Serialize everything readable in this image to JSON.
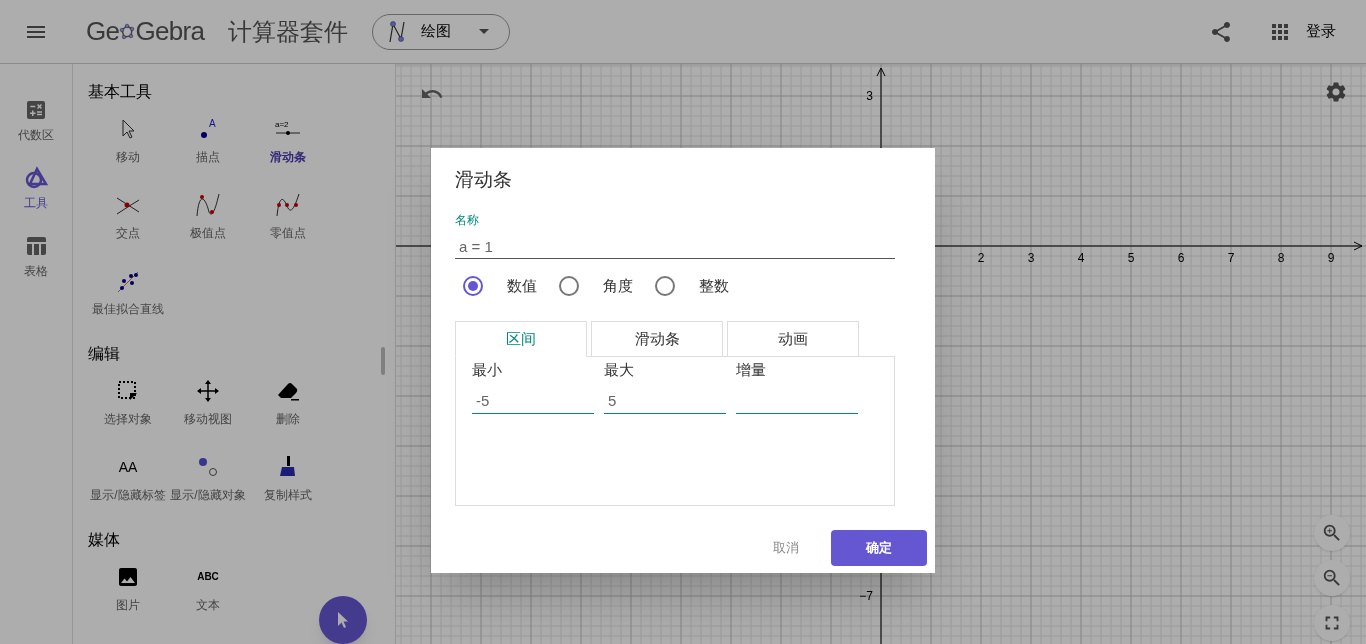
{
  "header": {
    "logo_parts": [
      "Ge",
      "Gebra"
    ],
    "suite_title": "计算器套件",
    "app_menu": {
      "label": "绘图"
    },
    "login": "登录"
  },
  "rail": [
    {
      "label": "代数区",
      "selected": false
    },
    {
      "label": "工具",
      "selected": true
    },
    {
      "label": "表格",
      "selected": false
    }
  ],
  "tool_sections": [
    {
      "title": "基本工具",
      "items": [
        {
          "label": "移动",
          "selected": false
        },
        {
          "label": "描点",
          "icon_text": "A",
          "selected": false
        },
        {
          "label": "滑动条",
          "icon_text": "a=2",
          "selected": true
        },
        {
          "label": "交点",
          "selected": false
        },
        {
          "label": "极值点",
          "selected": false
        },
        {
          "label": "零值点",
          "selected": false
        },
        {
          "label": "最佳拟合直线",
          "selected": false
        }
      ]
    },
    {
      "title": "编辑",
      "items": [
        {
          "label": "选择对象",
          "selected": false
        },
        {
          "label": "移动视图",
          "selected": false
        },
        {
          "label": "删除",
          "selected": false
        },
        {
          "label": "显示/隐藏标签",
          "icon_text": "AA",
          "selected": false
        },
        {
          "label": "显示/隐藏对象",
          "selected": false
        },
        {
          "label": "复制样式",
          "selected": false
        }
      ]
    },
    {
      "title": "媒体",
      "items": [
        {
          "label": "图片",
          "selected": false
        },
        {
          "label": "文本",
          "icon_text": "ABC",
          "selected": false
        }
      ]
    }
  ],
  "graph": {
    "x_labels": [
      "2",
      "3",
      "4",
      "5",
      "6",
      "7",
      "8",
      "9"
    ],
    "y_labels": [
      "3",
      "−7"
    ]
  },
  "dialog": {
    "title": "滑动条",
    "name_field": {
      "label": "名称",
      "value": "a = 1"
    },
    "types": [
      {
        "label": "数值",
        "selected": true
      },
      {
        "label": "角度",
        "selected": false
      },
      {
        "label": "整数",
        "selected": false
      }
    ],
    "tabs": [
      {
        "label": "区间",
        "selected": true
      },
      {
        "label": "滑动条",
        "selected": false
      },
      {
        "label": "动画",
        "selected": false
      }
    ],
    "fields": [
      {
        "label": "最小",
        "value": "-5"
      },
      {
        "label": "最大",
        "value": "5"
      },
      {
        "label": "增量"
      }
    ],
    "buttons": {
      "cancel": "取消",
      "ok": "确定"
    }
  }
}
